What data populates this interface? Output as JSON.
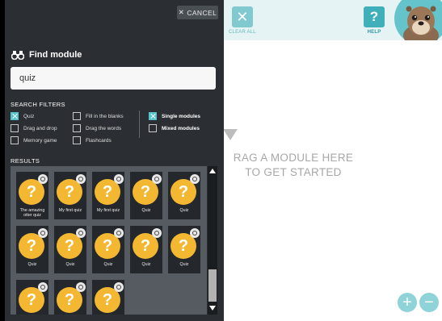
{
  "topbar": {
    "clear_all_label": "CLEAR ALL",
    "help_label": "HELP",
    "help_glyph": "?",
    "clear_glyph": "✕"
  },
  "canvas": {
    "drop_text_line1": "RAG A MODULE HERE",
    "drop_text_line2": "TO GET STARTED",
    "zoom_in": "+",
    "zoom_out": "−"
  },
  "panel": {
    "cancel_label": "CANCEL",
    "cancel_glyph": "✕",
    "title": "Find module",
    "search_value": "quiz",
    "filters_heading": "SEARCH FILTERS",
    "results_heading": "RESULTS",
    "filters": [
      {
        "label": "Quiz",
        "checked": true
      },
      {
        "label": "Fill in the blanks",
        "checked": false
      },
      {
        "label": "Drag and drop",
        "checked": false
      },
      {
        "label": "Drag the words",
        "checked": false
      },
      {
        "label": "Memory game",
        "checked": false
      },
      {
        "label": "Flashcards",
        "checked": false
      }
    ],
    "scope_filters": [
      {
        "label": "Single modules",
        "checked": true
      },
      {
        "label": "Mixed modules",
        "checked": false
      }
    ],
    "results": [
      "The amazing otter quiz",
      "My first quiz",
      "My first quiz",
      "Quiz",
      "Quiz",
      "Quiz",
      "Quiz",
      "Quiz",
      "Quiz",
      "Quiz",
      "",
      "",
      ""
    ],
    "result_glyph": "?"
  },
  "colors": {
    "panel_bg": "#2b2f33",
    "accent_teal": "#59c3cb",
    "module_icon": "#f4b731",
    "topbar_bg": "#e6f3f4"
  }
}
